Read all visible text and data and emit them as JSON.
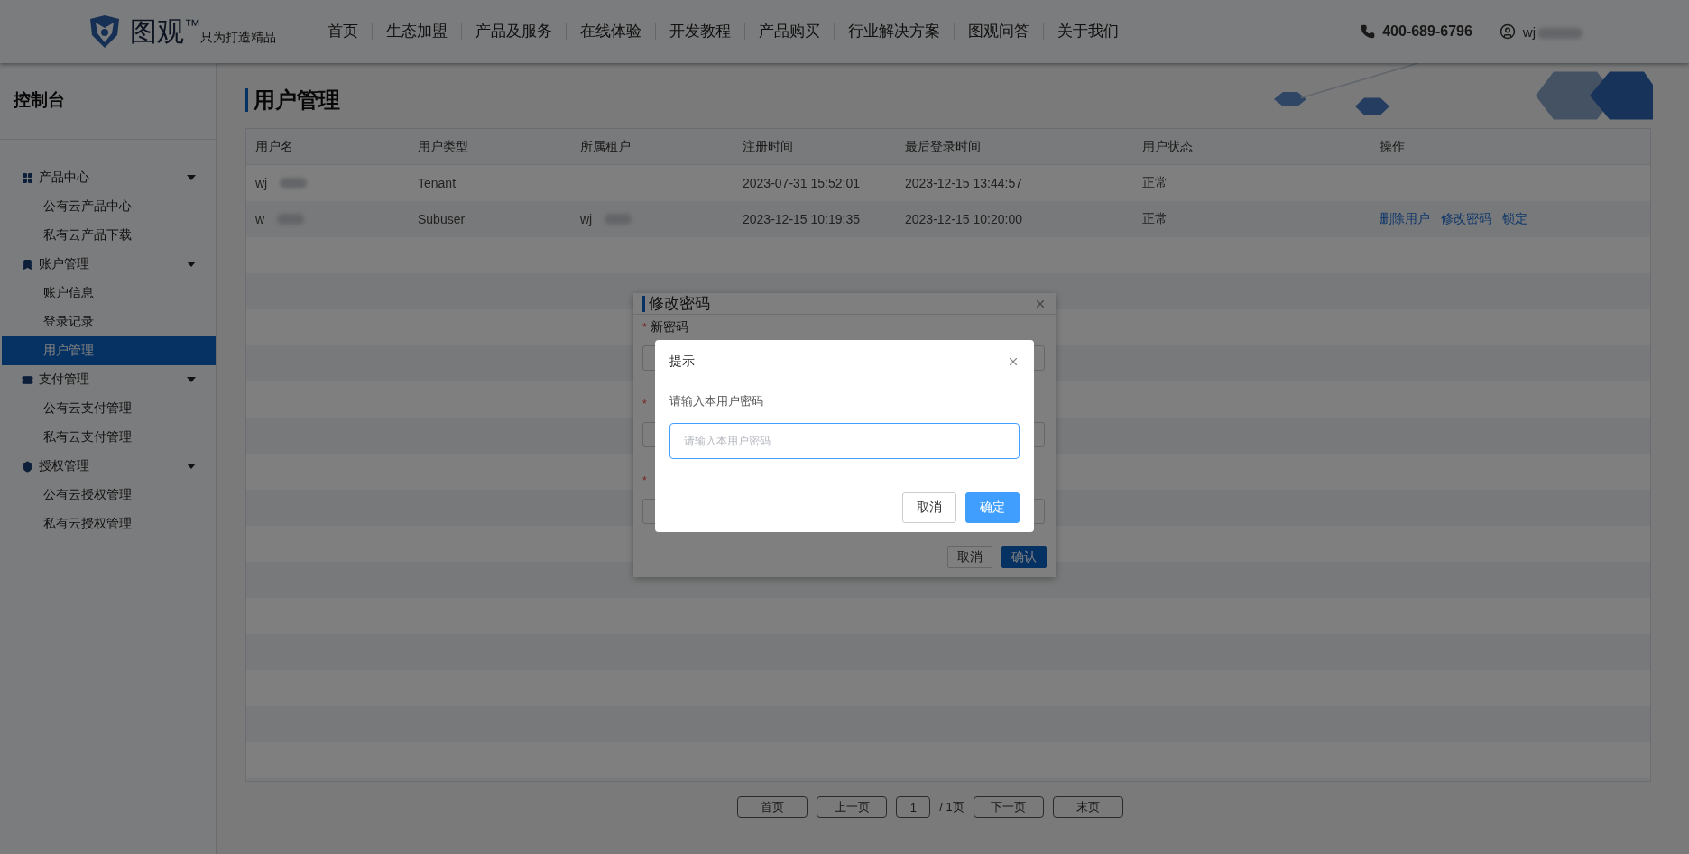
{
  "header": {
    "logo_text": "图观",
    "logo_mark": "™",
    "slogan": "只为打造精品",
    "nav": [
      {
        "label": "首页"
      },
      {
        "label": "生态加盟"
      },
      {
        "label": "产品及服务"
      },
      {
        "label": "在线体验"
      },
      {
        "label": "开发教程"
      },
      {
        "label": "产品购买"
      },
      {
        "label": "行业解决方案"
      },
      {
        "label": "图观问答"
      },
      {
        "label": "关于我们"
      }
    ],
    "phone": "400-689-6796",
    "user": "wj"
  },
  "sidebar": {
    "title": "控制台",
    "groups": [
      {
        "label": "产品中心",
        "expanded": true,
        "items": [
          {
            "label": "公有云产品中心",
            "selected": false
          },
          {
            "label": "私有云产品下载",
            "selected": false
          }
        ]
      },
      {
        "label": "账户管理",
        "expanded": true,
        "items": [
          {
            "label": "账户信息",
            "selected": false
          },
          {
            "label": "登录记录",
            "selected": false
          },
          {
            "label": "用户管理",
            "selected": true
          }
        ]
      },
      {
        "label": "支付管理",
        "expanded": true,
        "items": [
          {
            "label": "公有云支付管理",
            "selected": false
          },
          {
            "label": "私有云支付管理",
            "selected": false
          }
        ]
      },
      {
        "label": "授权管理",
        "expanded": true,
        "items": [
          {
            "label": "公有云授权管理",
            "selected": false
          },
          {
            "label": "私有云授权管理",
            "selected": false
          }
        ]
      }
    ]
  },
  "page_title": "用户管理",
  "table": {
    "columns": [
      "用户名",
      "用户类型",
      "所属租户",
      "注册时间",
      "最后登录时间",
      "用户状态",
      "操作"
    ],
    "rows": [
      {
        "cells": [
          {
            "text": "wj",
            "redacted": true
          },
          {
            "text": "Tenant"
          },
          {
            "text": ""
          },
          {
            "text": "2023-07-31 15:52:01"
          },
          {
            "text": "2023-12-15 13:44:57"
          },
          {
            "text": "正常"
          }
        ],
        "actions": []
      },
      {
        "cells": [
          {
            "text": "w",
            "redacted": true
          },
          {
            "text": "Subuser"
          },
          {
            "text": "wj",
            "redacted": true
          },
          {
            "text": "2023-12-15 10:19:35"
          },
          {
            "text": "2023-12-15 10:20:00"
          },
          {
            "text": "正常"
          }
        ],
        "actions": [
          "删除用户",
          "修改密码",
          "锁定"
        ]
      }
    ]
  },
  "pagination": {
    "first": "首页",
    "prev": "上一页",
    "page": "1",
    "total": "/ 1页",
    "next": "下一页",
    "last": "末页"
  },
  "password_dialog": {
    "title": "修改密码",
    "fields": [
      {
        "marker": "*",
        "label": "新密码"
      },
      {
        "marker": "*"
      },
      {
        "marker": "*"
      }
    ],
    "buttons": [
      {
        "label": "取消",
        "kind": "default"
      },
      {
        "label": "确认",
        "kind": "primary"
      }
    ]
  },
  "prompt_dialog": {
    "title": "提示",
    "message": "请输入本用户密码",
    "placeholder": "请输入本用户密码",
    "buttons": [
      {
        "label": "取消",
        "kind": "default"
      },
      {
        "label": "确定",
        "kind": "primary"
      }
    ]
  }
}
